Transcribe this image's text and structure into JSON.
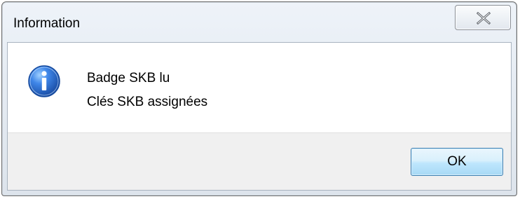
{
  "window": {
    "title": "Information"
  },
  "titlebar": {
    "close_icon": "close-icon"
  },
  "dialog": {
    "icon": "information-icon",
    "message_lines": [
      "Badge SKB lu",
      "Clés SKB assignées"
    ],
    "ok_label": "OK"
  },
  "colors": {
    "titlebar_bg": "#e6ecf3",
    "content_bg": "#ffffff",
    "button_bar_bg": "#f0f0f0",
    "ok_button_border": "#3c7fb1",
    "info_icon": "#2f67c8"
  }
}
